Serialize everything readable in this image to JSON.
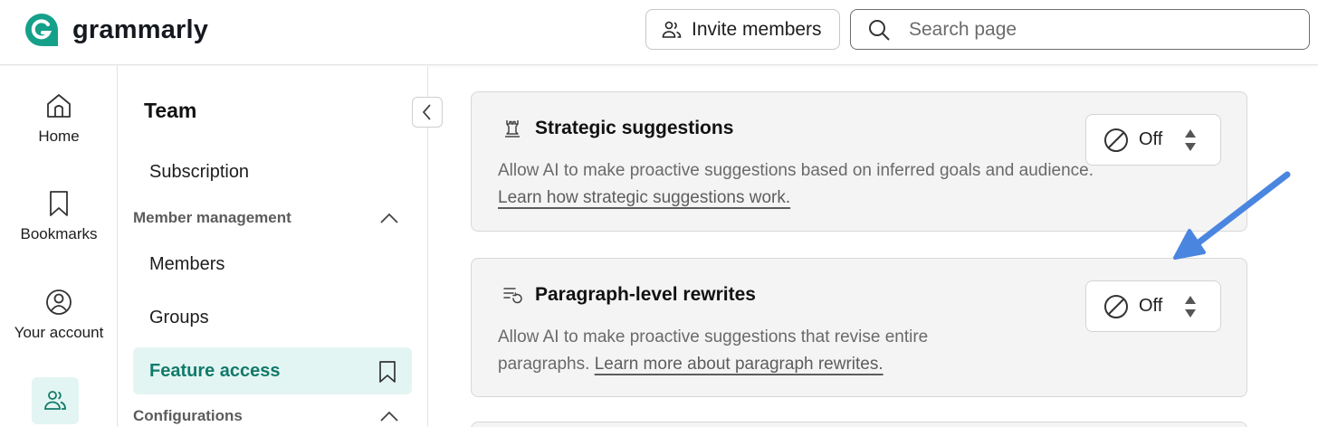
{
  "header": {
    "logo_text": "grammarly",
    "invite_label": "Invite members",
    "search_placeholder": "Search page"
  },
  "rail": {
    "items": [
      {
        "label": "Home",
        "icon": "home-icon"
      },
      {
        "label": "Bookmarks",
        "icon": "bookmark-icon"
      },
      {
        "label": "Your account",
        "icon": "account-icon"
      },
      {
        "label": "",
        "icon": "team-icon"
      }
    ]
  },
  "subnav": {
    "title": "Team",
    "subscription": "Subscription",
    "member_management": "Member management",
    "members": "Members",
    "groups": "Groups",
    "feature_access": "Feature access",
    "configurations": "Configurations"
  },
  "cards": [
    {
      "title": "Strategic suggestions",
      "icon": "chess-rook-icon",
      "desc": "Allow AI to make proactive suggestions based on inferred goals and audience.",
      "link": "Learn how strategic suggestions work.",
      "toggle_value": "Off"
    },
    {
      "title": "Paragraph-level rewrites",
      "icon": "paragraph-rewrite-icon",
      "desc": "Allow AI to make proactive suggestions that revise entire paragraphs.",
      "link": "Learn more about paragraph rewrites.",
      "toggle_value": "Off"
    }
  ],
  "colors": {
    "brand_green": "#15a08a",
    "active_bg": "#e3f5f2",
    "active_text": "#117a6b",
    "annotation_arrow": "#4a86e0"
  }
}
